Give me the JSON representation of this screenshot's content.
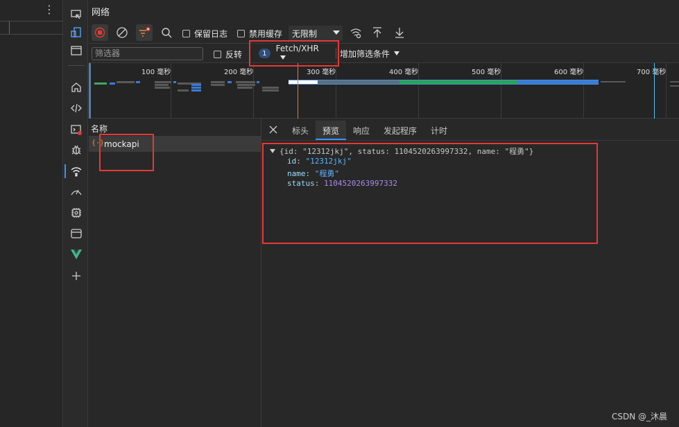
{
  "panel_title": "网络",
  "toolbar": {
    "preserve_log": "保留日志",
    "disable_cache": "禁用缓存",
    "throttle": "无限制"
  },
  "filter": {
    "placeholder": "筛选器",
    "invert": "反转",
    "type_count": "1",
    "type_label": "Fetch/XHR",
    "add_filter": "增加筛选条件"
  },
  "timeline": {
    "ticks": [
      "100 毫秒",
      "200 毫秒",
      "300 毫秒",
      "400 毫秒",
      "500 毫秒",
      "600 毫秒",
      "700 毫秒"
    ]
  },
  "request_list": {
    "header": "名称",
    "items": [
      {
        "icon": "{·}",
        "name": "mockapi"
      }
    ]
  },
  "detail_tabs": [
    "标头",
    "预览",
    "响应",
    "发起程序",
    "计时"
  ],
  "active_tab": "预览",
  "preview": {
    "summary": "{id: \"12312jkj\", status: 1104520263997332, name: \"程勇\"}",
    "fields": [
      {
        "key": "id",
        "value": "\"12312jkj\"",
        "type": "string"
      },
      {
        "key": "name",
        "value": "\"程勇\"",
        "type": "string"
      },
      {
        "key": "status",
        "value": "1104520263997332",
        "type": "number"
      }
    ]
  },
  "watermark": "CSDN @_沐晨",
  "colors": {
    "accent": "#3794ff",
    "highlight_box": "#e53935",
    "string_value": "#5cb3ff",
    "number_value": "#a98bf0"
  }
}
